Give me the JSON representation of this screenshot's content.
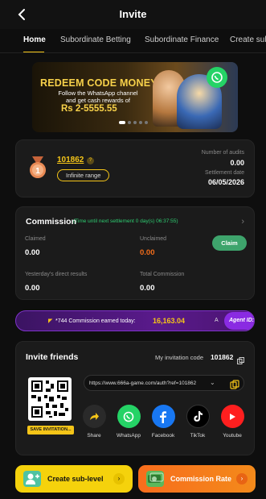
{
  "header": {
    "title": "Invite"
  },
  "tabs": [
    {
      "label": "Home"
    },
    {
      "label": "Subordinate Betting"
    },
    {
      "label": "Subordinate Finance"
    },
    {
      "label": "Create sul"
    }
  ],
  "banner": {
    "title": "REDEEM CODE MONEY",
    "subtitle_line1": "Follow the WhatsApp channel",
    "subtitle_line2": "and get cash rewards of",
    "amount": "Rs 2-5555.55"
  },
  "level_card": {
    "user_id": "101862",
    "range_label": "Infinite range",
    "audits_label": "Number of audits",
    "audits_value": "0.00",
    "settlement_label": "Settlement date",
    "settlement_value": "06/05/2026"
  },
  "commission": {
    "title": "Commission",
    "timer": "(Time until next settlement 0 day(s) 06:37:55)",
    "claimed_label": "Claimed",
    "claimed_value": "0.00",
    "unclaimed_label": "Unclaimed",
    "unclaimed_value": "0.00",
    "claim_button": "Claim",
    "yesterday_label": "Yesterday's direct results",
    "yesterday_value": "0.00",
    "total_label": "Total Commission",
    "total_value": "0.00",
    "unclaimed_color": "#f36d1b"
  },
  "ticker": {
    "text": "*744 Commission earned today:",
    "amount": "16,163.04",
    "tail": "A",
    "agent_tag": "Agent ID:"
  },
  "invite": {
    "title": "Invite friends",
    "code_label": "My invitation code",
    "code_value": "101862",
    "link": "https://www.666a-game.com/auth?ref=101862",
    "save_button": "SAVE INVITATION..."
  },
  "share": [
    {
      "label": "Share",
      "icon": "share-arrow-icon",
      "color": "#2a2a2a"
    },
    {
      "label": "WhatsApp",
      "icon": "whatsapp-icon",
      "color": "#25d366"
    },
    {
      "label": "Facebook",
      "icon": "facebook-icon",
      "color": "#1877f2"
    },
    {
      "label": "TikTok",
      "icon": "tiktok-icon",
      "color": "#000000"
    },
    {
      "label": "Youtube",
      "icon": "youtube-icon",
      "color": "#ff1f1f"
    }
  ],
  "actions": {
    "create_sub_label": "Create sub-level",
    "commission_rate_label": "Commission Rate"
  },
  "colors": {
    "accent": "#f5c518",
    "background": "#0e0e0e",
    "card": "#1b1b1b"
  }
}
